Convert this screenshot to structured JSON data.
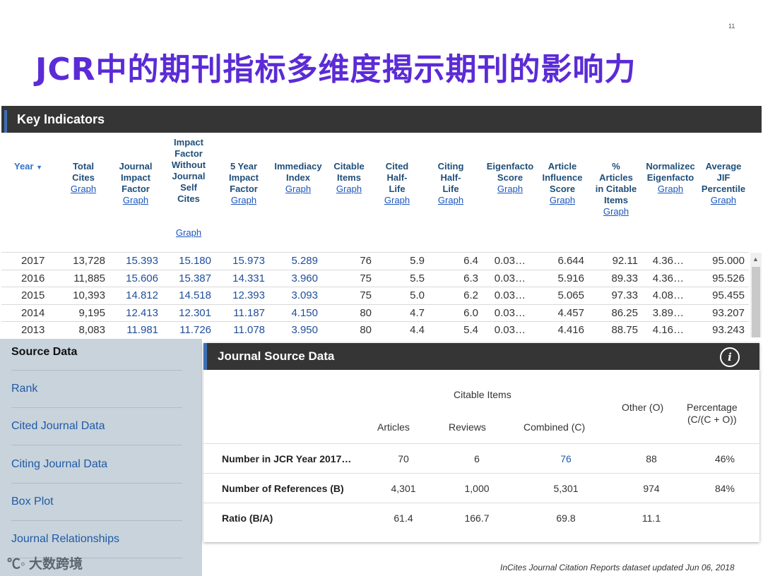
{
  "slide": {
    "number": "11",
    "title": "JCR中的期刊指标多维度揭示期刊的影响力",
    "brand": "大数跨境",
    "footer": "InCites Journal Citation Reports dataset updated Jun 06, 2018"
  },
  "key_indicators": {
    "title": "Key Indicators",
    "year_header": "Year",
    "graph_label": "Graph",
    "columns": [
      "Total\nCites",
      "Journal\nImpact\nFactor",
      "Impact\nFactor\nWithout\nJournal\nSelf\nCites",
      "5 Year\nImpact\nFactor",
      "Immediacy\nIndex",
      "Citable\nItems",
      "Cited\nHalf-\nLife",
      "Citing\nHalf-\nLife",
      "Eigenfacto\nScore",
      "Article\nInfluence\nScore",
      "%\nArticles\nin Citable\nItems",
      "Normalizec\nEigenfacto",
      "Average\nJIF\nPercentile"
    ],
    "rows": [
      [
        "2017",
        "13,728",
        "15.393",
        "15.180",
        "15.973",
        "5.289",
        "76",
        "5.9",
        "6.4",
        "0.03…",
        "6.644",
        "92.11",
        "4.36…",
        "95.000"
      ],
      [
        "2016",
        "11,885",
        "15.606",
        "15.387",
        "14.331",
        "3.960",
        "75",
        "5.5",
        "6.3",
        "0.03…",
        "5.916",
        "89.33",
        "4.36…",
        "95.526"
      ],
      [
        "2015",
        "10,393",
        "14.812",
        "14.518",
        "12.393",
        "3.093",
        "75",
        "5.0",
        "6.2",
        "0.03…",
        "5.065",
        "97.33",
        "4.08…",
        "95.455"
      ],
      [
        "2014",
        "9,195",
        "12.413",
        "12.301",
        "11.187",
        "4.150",
        "80",
        "4.7",
        "6.0",
        "0.03…",
        "4.457",
        "86.25",
        "3.89…",
        "93.207"
      ],
      [
        "2013",
        "8,083",
        "11.981",
        "11.726",
        "11.078",
        "3.950",
        "80",
        "4.4",
        "5.4",
        "0.03…",
        "4.416",
        "88.75",
        "4.16…",
        "93.243"
      ]
    ]
  },
  "sidebar": {
    "heading": "Source Data",
    "items": [
      "Rank",
      "Cited Journal Data",
      "Citing Journal Data",
      "Box Plot",
      "Journal Relationships"
    ]
  },
  "journal_source_data": {
    "title": "Journal Source Data",
    "group_header": "Citable Items",
    "headers": {
      "articles": "Articles",
      "reviews": "Reviews",
      "combined": "Combined  (C)",
      "other": "Other (O)",
      "percentage": "Percentage\n(C/(C + O))"
    },
    "rows": [
      {
        "label": "Number in JCR Year 2017…",
        "articles": "70",
        "reviews": "6",
        "combined": "76",
        "other": "88",
        "percentage": "46%"
      },
      {
        "label": "Number of References (B)",
        "articles": "4,301",
        "reviews": "1,000",
        "combined": "5,301",
        "other": "974",
        "percentage": "84%"
      },
      {
        "label": "Ratio (B/A)",
        "articles": "61.4",
        "reviews": "166.7",
        "combined": "69.8",
        "other": "11.1",
        "percentage": ""
      }
    ]
  },
  "colors": {
    "title_purple": "#5b2bd6",
    "header_dark": "#353535",
    "link_blue": "#1f5aa6",
    "sidebar_bg": "#c8d3dc"
  }
}
